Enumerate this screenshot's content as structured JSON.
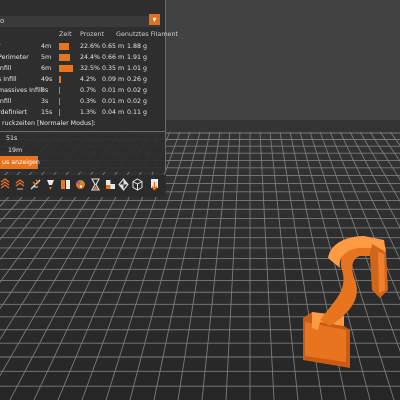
{
  "stats": {
    "header_row": {
      "value": "o",
      "arrow": "▾"
    },
    "col_time": "Zeit",
    "col_percent": "Prozent",
    "col_filament": "Genutztes Filament",
    "rows": [
      {
        "name": "r",
        "time": "4m",
        "percent": "22.6%",
        "length": "0.65 m",
        "weight": "1.88 g",
        "fraction": 0.226
      },
      {
        "name": "Perimeter",
        "time": "5m",
        "percent": "24.4%",
        "length": "0.66 m",
        "weight": "1.91 g",
        "fraction": 0.244
      },
      {
        "name": "Infill",
        "time": "6m",
        "percent": "32.5%",
        "length": "0.35 m",
        "weight": "1.01 g",
        "fraction": 0.325
      },
      {
        "name": "s Infill",
        "time": "49s",
        "percent": "4.2%",
        "length": "0.09 m",
        "weight": "0.26 g",
        "fraction": 0.042
      },
      {
        "name": "massives Infill",
        "time": "8s",
        "percent": "0.7%",
        "length": "0.01 m",
        "weight": "0.02 g",
        "fraction": 0.007
      },
      {
        "name": "Infill",
        "time": "3s",
        "percent": "0.3%",
        "length": "0.01 m",
        "weight": "0.02 g",
        "fraction": 0.003
      },
      {
        "name": "rdefiniert",
        "time": "15s",
        "percent": "1.3%",
        "length": "0.04 m",
        "weight": "0.11 g",
        "fraction": 0.013
      }
    ],
    "estimated_label": "ruckzeiten [Normaler Modus]:",
    "time_first": "51s",
    "time_total": "19m",
    "show_button": "us anzeigen"
  },
  "toolbar": {
    "icons": [
      "layers-icon",
      "shells-icon",
      "seams-icon",
      "retractions-icon",
      "wipe-icon",
      "color-change-icon",
      "pause-icon",
      "custom-gcode-icon",
      "bed-icon",
      "cube-icon",
      "export-icon"
    ]
  },
  "colors": {
    "accent": "#e8741f",
    "part": "#e8741f",
    "grid": "#7b7b7b",
    "floor": "#2d2d2d"
  }
}
